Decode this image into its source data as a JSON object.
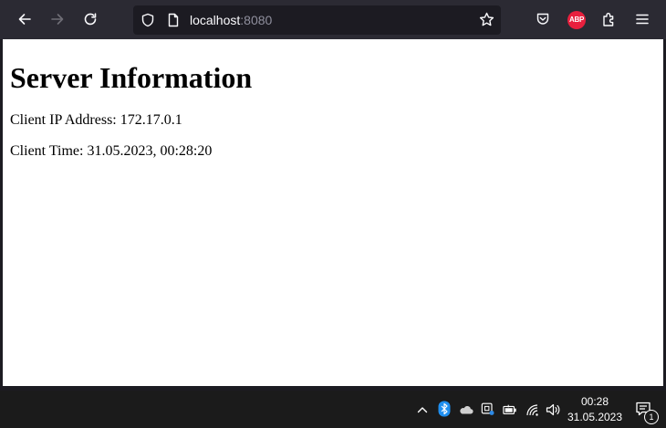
{
  "browser": {
    "url_host": "localhost",
    "url_port": ":8080",
    "extension_badge": "ABP",
    "icons": {
      "back": "arrow-left-icon",
      "forward": "arrow-right-icon",
      "reload": "reload-icon",
      "tracking": "shield-icon",
      "page": "page-icon",
      "bookmark": "star-icon",
      "pocket": "pocket-icon",
      "extensions": "puzzle-icon",
      "menu": "hamburger-menu-icon"
    },
    "colors": {
      "toolbar": "#2b2a33",
      "urlbar": "#1c1b22",
      "abp": "#e8203e"
    }
  },
  "page": {
    "title": "Server Information",
    "client_ip": "Client IP Address: 172.17.0.1",
    "client_time": "Client Time: 31.05.2023, 00:28:20"
  },
  "taskbar": {
    "time": "00:28",
    "date": "31.05.2023",
    "notification_count": "1",
    "tray_icons": [
      "chevron-up-icon",
      "bluetooth-icon",
      "onedrive-cloud-icon",
      "meet-now-icon",
      "battery-icon",
      "wifi-icon",
      "speaker-icon",
      "notification-icon"
    ]
  }
}
